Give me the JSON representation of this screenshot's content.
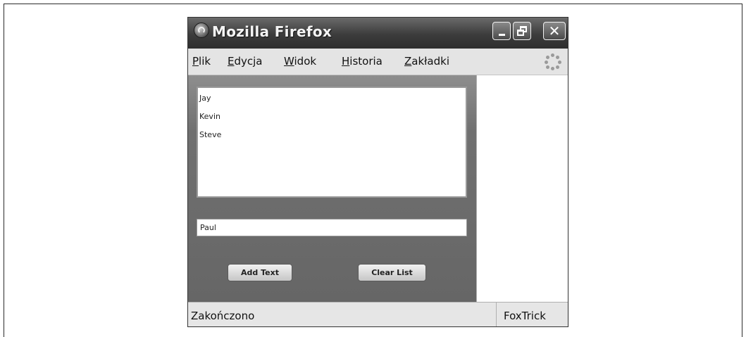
{
  "window": {
    "title": "Mozilla Firefox",
    "controls": {
      "minimize_icon": "minimize-icon",
      "restore_icon": "restore-icon",
      "close_icon": "close-icon"
    }
  },
  "menu": {
    "items": [
      {
        "label": "Plik",
        "accesskey": "P"
      },
      {
        "label": "Edycja",
        "accesskey": "E"
      },
      {
        "label": "Widok",
        "accesskey": "W"
      },
      {
        "label": "Historia",
        "accesskey": "H"
      },
      {
        "label": "Zakładki",
        "accesskey": "Z"
      }
    ],
    "throbber_icon": "throbber-icon"
  },
  "list": {
    "items": [
      "Jay",
      "Kevin",
      "Steve"
    ]
  },
  "input": {
    "value": "Paul"
  },
  "buttons": {
    "add_label": "Add Text",
    "clear_label": "Clear List"
  },
  "status": {
    "text": "Zakończono",
    "extension": "FoxTrick"
  },
  "colors": {
    "titlebar": "#3c3c3c",
    "content_panel": "#707070",
    "sidebar": "#ffffff"
  }
}
